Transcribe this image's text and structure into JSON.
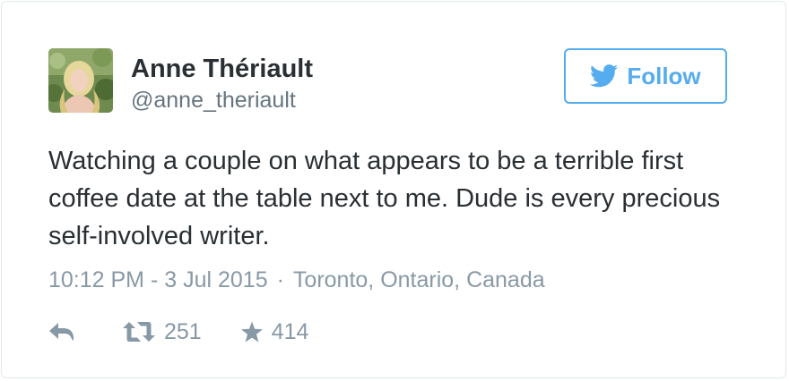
{
  "user": {
    "display_name": "Anne Thériault",
    "handle": "@anne_theriault",
    "avatar_icon": "user-avatar"
  },
  "follow": {
    "label": "Follow",
    "icon": "twitter-bird-icon",
    "color": "#55acee"
  },
  "tweet": {
    "text": "Watching a couple on what appears to be a terrible first coffee date at the table next to me. Dude is every precious self-involved writer.",
    "timestamp": "10:12 PM - 3 Jul 2015",
    "separator": "·",
    "location": "Toronto, Ontario, Canada"
  },
  "actions": {
    "reply_icon": "reply-icon",
    "retweet_icon": "retweet-icon",
    "retweet_count": "251",
    "favorite_icon": "star-icon",
    "favorite_count": "414"
  },
  "colors": {
    "text": "#292f33",
    "secondary": "#66757f",
    "muted": "#8899a6",
    "accent": "#55acee",
    "border": "#e1e8ed"
  }
}
